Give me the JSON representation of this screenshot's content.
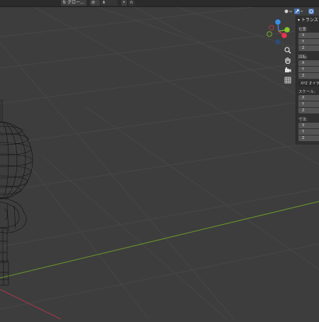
{
  "header": {
    "orientation_label": "グロー...",
    "snap_label": "",
    "proportional_label": ""
  },
  "nav_gizmo": {
    "axes": [
      "X",
      "Y",
      "Z"
    ],
    "colors": {
      "x": "#e8354c",
      "y": "#84c82a",
      "z": "#3b8ee8"
    }
  },
  "viewport_tools": [
    "zoom-icon",
    "hand-pan-icon",
    "camera-icon",
    "grid-view-icon"
  ],
  "npanel": {
    "title": "▾ トランス",
    "location": {
      "label": "位置:",
      "axes": [
        "X",
        "Y",
        "Z"
      ]
    },
    "rotation": {
      "label": "回転:",
      "axes": [
        "X",
        "Y",
        "Z"
      ],
      "mode": "XYZ オイラ"
    },
    "scale": {
      "label": "スケール:",
      "axes": [
        "X",
        "Y",
        "Z"
      ]
    },
    "dimensions": {
      "label": "寸法:",
      "axes": [
        "X",
        "Y",
        "Z"
      ]
    }
  },
  "colors": {
    "background": "#3d3d3d",
    "grid": "#4a4a4a",
    "x_axis": "#b53a4a",
    "y_axis": "#6c9a2a",
    "wireframe": "#0c0c0c"
  }
}
